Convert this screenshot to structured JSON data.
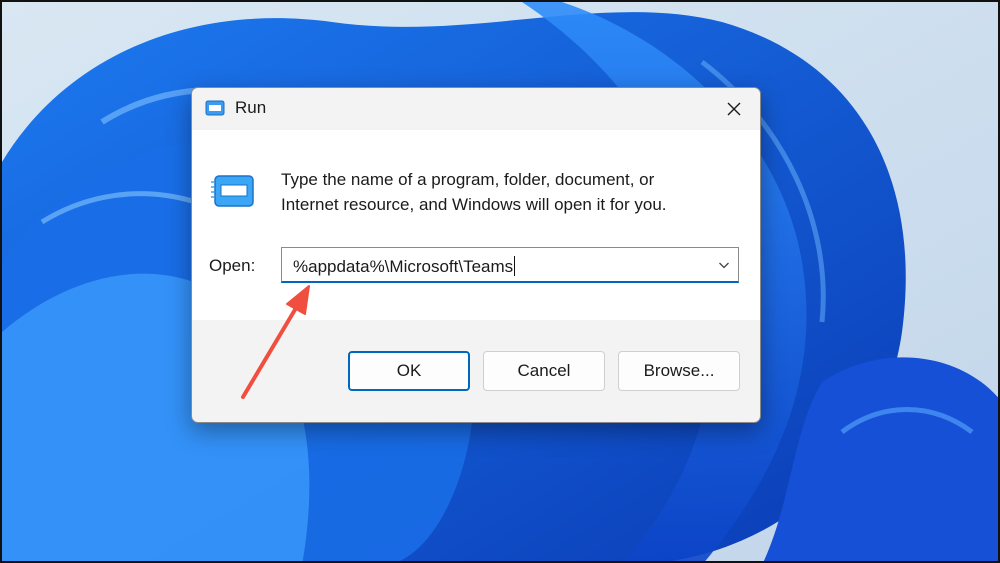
{
  "dialog": {
    "title": "Run",
    "description_line1": "Type the name of a program, folder, document, or",
    "description_line2": "Internet resource, and Windows will open it for you.",
    "open_label": "Open:",
    "open_value": "%appdata%\\Microsoft\\Teams",
    "buttons": {
      "ok": "OK",
      "cancel": "Cancel",
      "browse": "Browse..."
    }
  },
  "icons": {
    "title": "run-app-icon",
    "content": "run-app-icon",
    "close": "close-icon",
    "dropdown": "chevron-down-icon"
  },
  "colors": {
    "accent": "#0067c0",
    "annotation_arrow": "#f04e3e"
  }
}
